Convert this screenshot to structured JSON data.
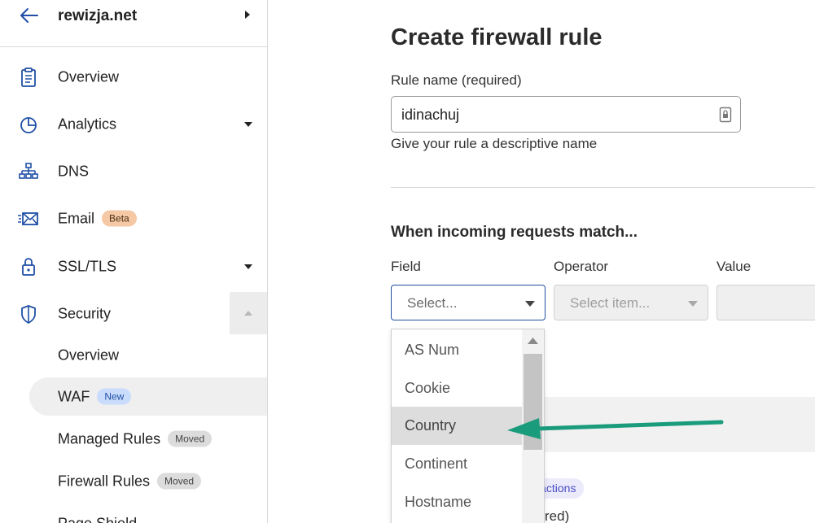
{
  "sidebar": {
    "site_name": "rewizja.net",
    "nav": [
      {
        "label": "Overview",
        "icon": "clipboard-icon"
      },
      {
        "label": "Analytics",
        "icon": "pie-chart-icon"
      },
      {
        "label": "DNS",
        "icon": "network-tree-icon"
      },
      {
        "label": "Email",
        "icon": "envelope-icon",
        "badge": "Beta"
      },
      {
        "label": "SSL/TLS",
        "icon": "lock-icon"
      },
      {
        "label": "Security",
        "icon": "shield-icon"
      }
    ],
    "security_sub": [
      {
        "label": "Overview"
      },
      {
        "label": "WAF",
        "badge": "New",
        "active": true
      },
      {
        "label": "Managed Rules",
        "badge": "Moved"
      },
      {
        "label": "Firewall Rules",
        "badge": "Moved"
      },
      {
        "label": "Page Shield"
      }
    ]
  },
  "main": {
    "title": "Create firewall rule",
    "rule_name_label": "Rule name (required)",
    "rule_name_value": "idinachuj",
    "rule_name_help": "Give your rule a descriptive name",
    "match_heading": "When incoming requests match...",
    "columns": {
      "field": "Field",
      "operator": "Operator",
      "value": "Value"
    },
    "field_placeholder": "Select...",
    "operator_placeholder": "Select item...",
    "partial_pill": "ll actions",
    "partial_required": "red)"
  },
  "dropdown": {
    "options": [
      "AS Num",
      "Cookie",
      "Country",
      "Continent",
      "Hostname"
    ],
    "highlighted": "Country"
  },
  "colors": {
    "accent_border": "#1e4f9e",
    "annotation_arrow": "#1a9c7c",
    "beta_badge": "#f6c9a6",
    "new_badge": "#c9dcfb"
  }
}
